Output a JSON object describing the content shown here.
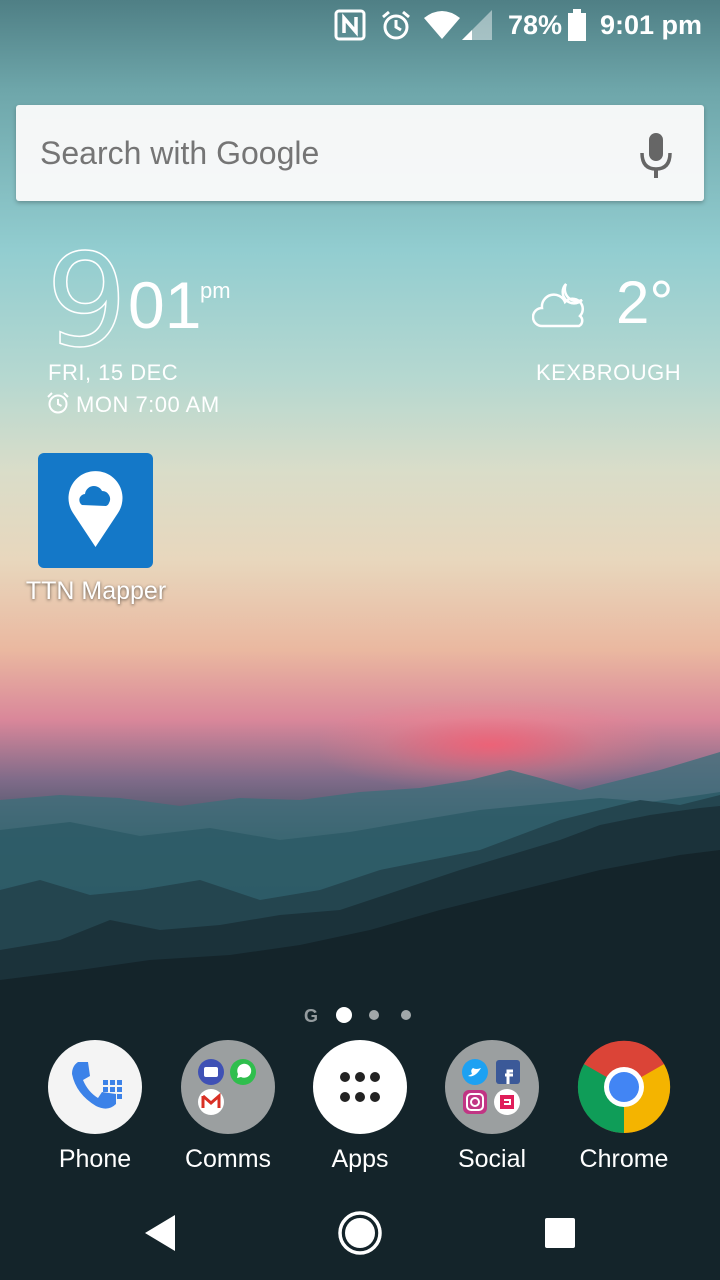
{
  "status_bar": {
    "icons": [
      "nfc-icon",
      "alarm-icon",
      "wifi-icon",
      "cell-signal-icon",
      "battery-icon"
    ],
    "battery": "78%",
    "time": "9:01 pm"
  },
  "search": {
    "placeholder": "Search with Google",
    "mic_icon": "mic-icon"
  },
  "clock_widget": {
    "hour": "9",
    "minutes": "01",
    "ampm": "pm",
    "date": "FRI, 15 DEC",
    "alarm": "MON 7:00 AM"
  },
  "weather_widget": {
    "icon": "partly-cloudy-night-icon",
    "temperature": "2°",
    "location": "KEXBROUGH"
  },
  "home_apps": [
    {
      "label": "TTN Mapper",
      "icon": "ttn-mapper-icon",
      "color": "#1478c8"
    }
  ],
  "pager": {
    "pages": 3,
    "current": 1,
    "google_marker": "G"
  },
  "dock": [
    {
      "label": "Phone",
      "icon": "phone-icon"
    },
    {
      "label": "Comms",
      "icon": "comms-folder-icon"
    },
    {
      "label": "Apps",
      "icon": "app-drawer-icon"
    },
    {
      "label": "Social",
      "icon": "social-folder-icon"
    },
    {
      "label": "Chrome",
      "icon": "chrome-icon"
    }
  ],
  "nav_bar": {
    "buttons": [
      "back-icon",
      "home-icon",
      "recents-icon"
    ]
  }
}
